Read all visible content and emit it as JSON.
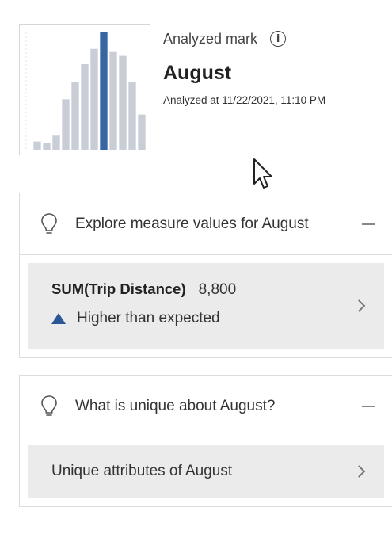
{
  "header": {
    "analyzed_label": "Analyzed mark",
    "mark_name": "August",
    "timestamp": "Analyzed at 11/22/2021, 11:10 PM"
  },
  "thumbnail": {
    "chart_data": {
      "type": "bar",
      "values": [
        0.07,
        0.06,
        0.12,
        0.43,
        0.58,
        0.73,
        0.86,
        1.0,
        0.84,
        0.8,
        0.58,
        0.3
      ],
      "highlight_index": 7,
      "bar_color": "#c9cdd6",
      "highlight_color": "#3766a3"
    }
  },
  "sections": [
    {
      "title": "Explore measure values for August",
      "card": {
        "measure_name": "SUM(Trip Distance)",
        "measure_value": "8,800",
        "status": "Higher than expected"
      }
    },
    {
      "title": "What is unique about August?",
      "card": {
        "label": "Unique attributes of August"
      }
    }
  ],
  "colors": {
    "accent": "#2b5797",
    "card_background": "#ebebeb",
    "border": "#dcdcdc"
  },
  "icons": {
    "info": "info-icon",
    "bulb": "lightbulb-icon",
    "collapse": "minus-icon",
    "chevron": "chevron-right-icon",
    "cursor": "mouse-pointer-icon"
  }
}
